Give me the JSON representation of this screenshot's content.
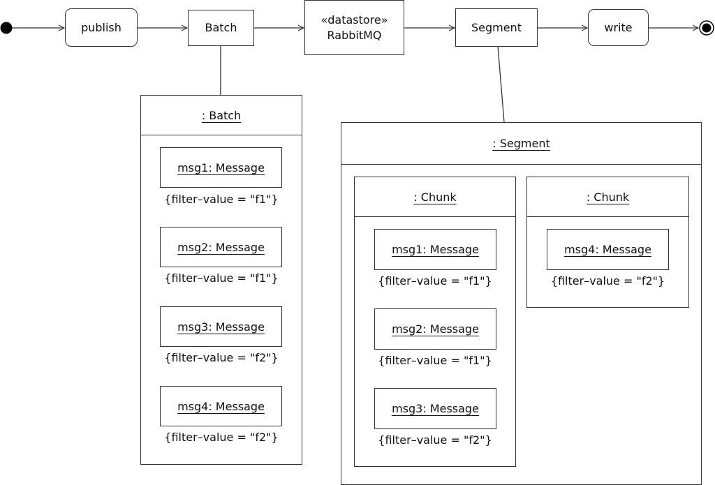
{
  "flow": {
    "publish": "publish",
    "batch": "Batch",
    "datastore_stereotype": "«datastore»",
    "datastore_name": "RabbitMQ",
    "segment": "Segment",
    "write": "write"
  },
  "batch_object": {
    "title": ":  Batch",
    "messages": [
      {
        "name": "msg1:  Message",
        "filter": "{filter–value = \"f1\"}"
      },
      {
        "name": "msg2:  Message",
        "filter": "{filter–value = \"f1\"}"
      },
      {
        "name": "msg3:  Message",
        "filter": "{filter–value = \"f2\"}"
      },
      {
        "name": "msg4:  Message",
        "filter": "{filter–value = \"f2\"}"
      }
    ]
  },
  "segment_object": {
    "title": ":  Segment",
    "chunks": [
      {
        "title": ":  Chunk",
        "messages": [
          {
            "name": "msg1:  Message",
            "filter": "{filter–value = \"f1\"}"
          },
          {
            "name": "msg2:  Message",
            "filter": "{filter–value = \"f1\"}"
          },
          {
            "name": "msg3:  Message",
            "filter": "{filter–value = \"f2\"}"
          }
        ]
      },
      {
        "title": ":  Chunk",
        "messages": [
          {
            "name": "msg4:  Message",
            "filter": "{filter–value = \"f2\"}"
          }
        ]
      }
    ]
  }
}
